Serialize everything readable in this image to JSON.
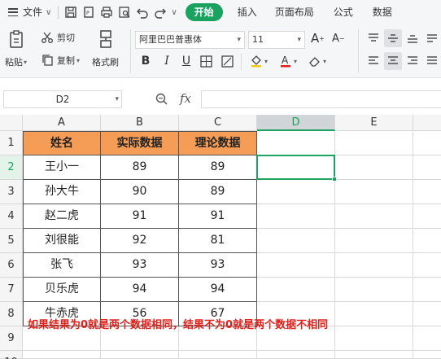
{
  "menu": {
    "file_label": "文件",
    "tabs": [
      {
        "label": "开始",
        "active": true
      },
      {
        "label": "插入",
        "active": false
      },
      {
        "label": "页面布局",
        "active": false
      },
      {
        "label": "公式",
        "active": false
      },
      {
        "label": "数据",
        "active": false
      }
    ]
  },
  "ribbon": {
    "cut_label": "剪切",
    "paste_label": "粘贴",
    "copy_label": "复制",
    "format_painter_label": "格式刷",
    "font_name": "阿里巴巴普惠体",
    "font_size": "11"
  },
  "formula_bar": {
    "name_box": "D2",
    "fx_label": "fx",
    "formula": ""
  },
  "sheet": {
    "columns": [
      "A",
      "B",
      "C",
      "D",
      "E"
    ],
    "rows": [
      "1",
      "2",
      "3",
      "4",
      "5",
      "6",
      "7",
      "8",
      "9",
      "10"
    ],
    "active_cell": "D2",
    "header_row": [
      "姓名",
      "实际数据",
      "理论数据"
    ],
    "data_rows": [
      [
        "王小一",
        "89",
        "89"
      ],
      [
        "孙大牛",
        "90",
        "89"
      ],
      [
        "赵二虎",
        "91",
        "91"
      ],
      [
        "刘很能",
        "92",
        "81"
      ],
      [
        "张飞",
        "93",
        "93"
      ],
      [
        "贝乐虎",
        "94",
        "94"
      ],
      [
        "牛赤虎",
        "56",
        "67"
      ]
    ],
    "note": "如果结果为0就是两个数据相同，结果不为0就是两个数据不相同"
  },
  "colors": {
    "accent": "#1aa260",
    "header_fill": "#f59d56",
    "note_text": "#e0201b"
  }
}
